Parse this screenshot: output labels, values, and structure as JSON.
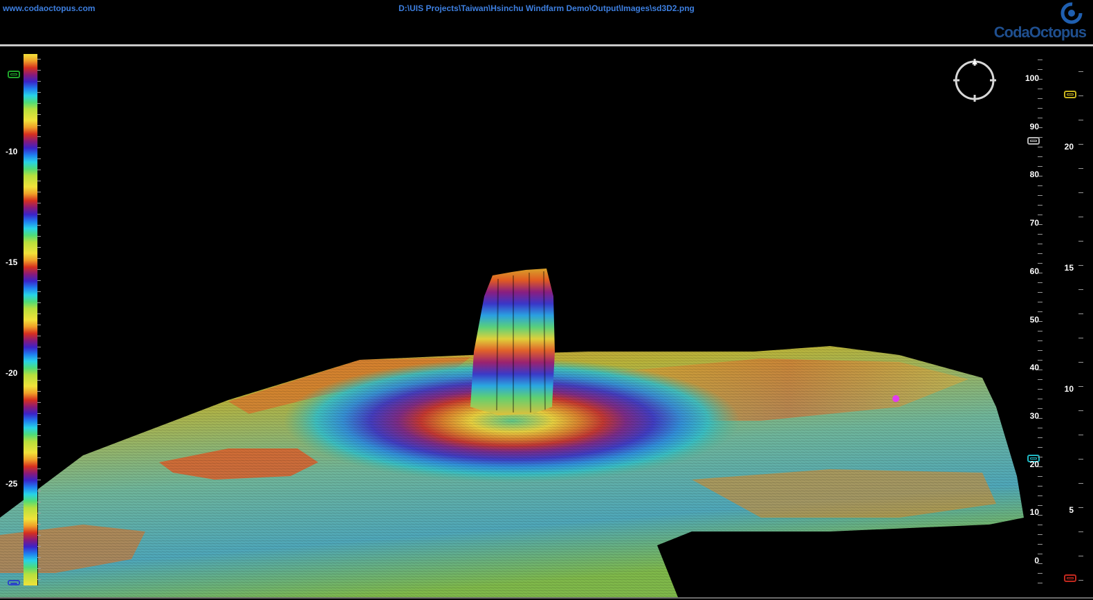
{
  "header": {
    "url": "www.codaoctopus.com",
    "file_path": "D:\\UIS Projects\\Taiwan\\Hsinchu Windfarm Demo\\Output\\Images\\sd3D2.png",
    "logo_text": "CodaOctopus"
  },
  "colorbar": {
    "ticks": [
      {
        "label": "-10",
        "value": -10
      },
      {
        "label": "-15",
        "value": -15
      },
      {
        "label": "-20",
        "value": -20
      },
      {
        "label": "-25",
        "value": -25
      }
    ]
  },
  "scale_inner": {
    "labels": [
      "100",
      "90",
      "80",
      "70",
      "60",
      "50",
      "40",
      "30",
      "20",
      "10",
      "0"
    ]
  },
  "scale_outer": {
    "labels": [
      "20",
      "15",
      "10",
      "5"
    ]
  },
  "markers": {
    "green": "#1fa32a",
    "yellow": "#c8b41e",
    "gray": "#b5b5b5",
    "cyan": "#1fb8c2",
    "red": "#c2281e",
    "blue": "#2b46c8",
    "magenta": "#e23cf0"
  },
  "colors": {
    "accent_text": "#3d7fe0",
    "logo": "#1f4f8f"
  }
}
